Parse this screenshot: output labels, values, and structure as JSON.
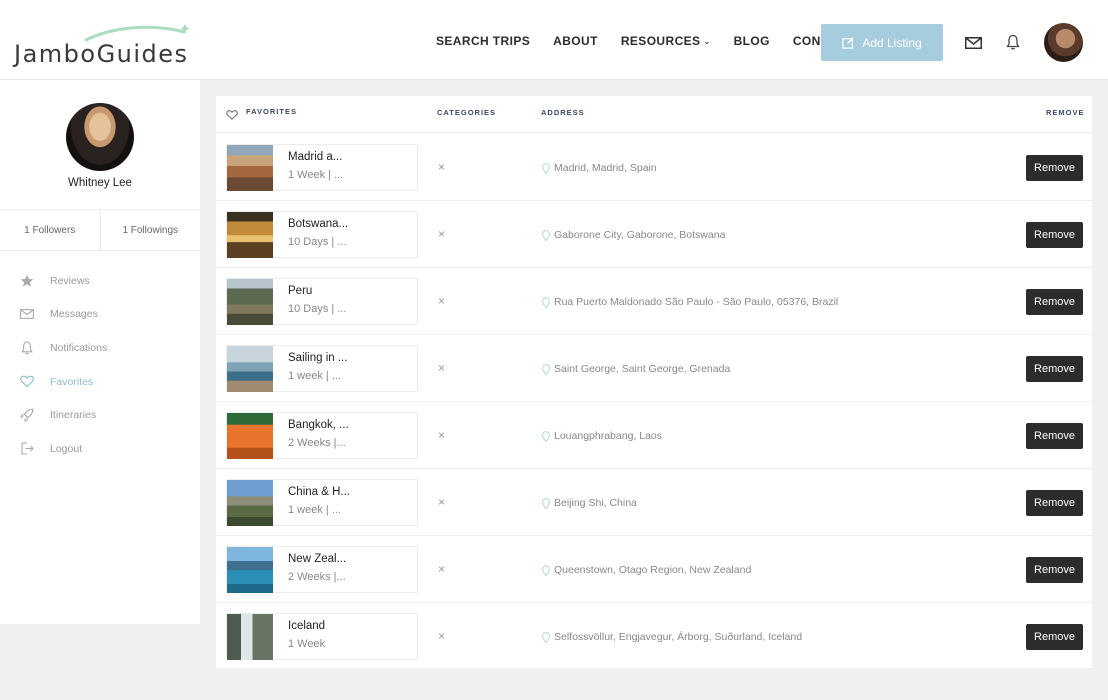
{
  "header": {
    "logo_text": "JamboGuides",
    "nav": [
      {
        "label": "SEARCH TRIPS",
        "dropdown": false
      },
      {
        "label": "ABOUT",
        "dropdown": false
      },
      {
        "label": "RESOURCES",
        "dropdown": true
      },
      {
        "label": "BLOG",
        "dropdown": false
      },
      {
        "label": "CONTACT",
        "dropdown": false
      }
    ],
    "add_listing_label": "Add Listing",
    "accent_color": "#a6cddd"
  },
  "sidebar": {
    "user_name": "Whitney Lee",
    "followers": "1 Followers",
    "followings": "1 Followings",
    "menu": [
      {
        "label": "Reviews",
        "icon": "star-icon"
      },
      {
        "label": "Messages",
        "icon": "mail-icon"
      },
      {
        "label": "Notifications",
        "icon": "bell-icon"
      },
      {
        "label": "Favorites",
        "icon": "heart-icon",
        "active": true
      },
      {
        "label": "Itineraries",
        "icon": "rocket-icon"
      },
      {
        "label": "Logout",
        "icon": "logout-icon"
      }
    ]
  },
  "table": {
    "headers": {
      "favorites": "FAVORITES",
      "categories": "CATEGORIES",
      "address": "ADDRESS",
      "remove": "REMOVE"
    },
    "rows": [
      {
        "title": "Madrid a...",
        "duration": "1 Week | ...",
        "category": "×",
        "address": "Madrid, Madrid, Spain",
        "remove_label": "Remove"
      },
      {
        "title": "Botswana...",
        "duration": "10 Days | ...",
        "category": "×",
        "address": "Gaborone City, Gaborone, Botswana",
        "remove_label": "Remove"
      },
      {
        "title": "Peru",
        "duration": "10 Days | ...",
        "category": "×",
        "address": "Rua Puerto Maldonado São Paulo - São Paulo, 05376, Brazil",
        "remove_label": "Remove"
      },
      {
        "title": "Sailing in ...",
        "duration": "1 week | ...",
        "category": "×",
        "address": "Saint George, Saint George, Grenada",
        "remove_label": "Remove"
      },
      {
        "title": "Bangkok, ...",
        "duration": "2 Weeks |...",
        "category": "×",
        "address": "Louangphrabang, Laos",
        "remove_label": "Remove"
      },
      {
        "title": "China & H...",
        "duration": "1 week | ...",
        "category": "×",
        "address": "Beijing Shi, China",
        "remove_label": "Remove"
      },
      {
        "title": "New Zeal...",
        "duration": "2 Weeks |...",
        "category": "×",
        "address": "Queenstown, Otago Region, New Zealand",
        "remove_label": "Remove"
      },
      {
        "title": "Iceland",
        "duration": "1 Week",
        "category": "×",
        "address": "Selfossvöllur, Engjavegur, Árborg, Suðurland, Iceland",
        "remove_label": "Remove"
      }
    ]
  }
}
